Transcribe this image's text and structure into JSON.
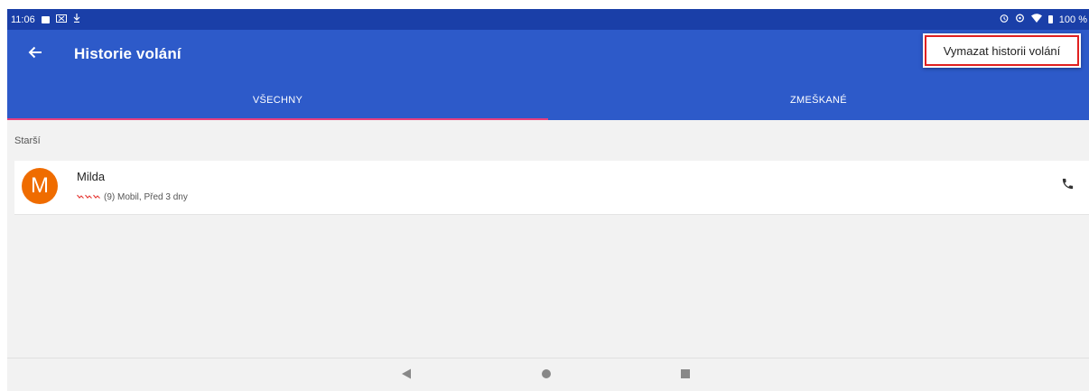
{
  "status_bar": {
    "time": "11:06",
    "battery": "100 %",
    "icons": [
      "notification-square-icon",
      "cast-icon",
      "download-icon",
      "alarm-icon",
      "data-saver-icon",
      "wifi-icon",
      "battery-icon"
    ]
  },
  "app_bar": {
    "back_icon": "arrow-left-icon",
    "title": "Historie volání",
    "menu_item": "Vymazat historii volání",
    "highlight_color": "#e02020"
  },
  "tabs": [
    {
      "label": "VŠECHNY",
      "selected": true
    },
    {
      "label": "ZMEŠKANÉ",
      "selected": false
    }
  ],
  "section_header": "Starší",
  "calls": [
    {
      "avatar_letter": "M",
      "avatar_color": "#ef6c00",
      "name": "Milda",
      "missed_icon": "missed-call-icon",
      "missed_count_icons": 3,
      "details": "(9) Mobil, Před 3 dny",
      "action_icon": "phone-icon"
    }
  ],
  "nav_bar": [
    "back-triangle-icon",
    "home-circle-icon",
    "recents-square-icon"
  ],
  "colors": {
    "status_bar": "#1a3fa8",
    "primary": "#2d5ac9",
    "tab_indicator": "#e83f7d",
    "missed_call": "#e53935"
  }
}
